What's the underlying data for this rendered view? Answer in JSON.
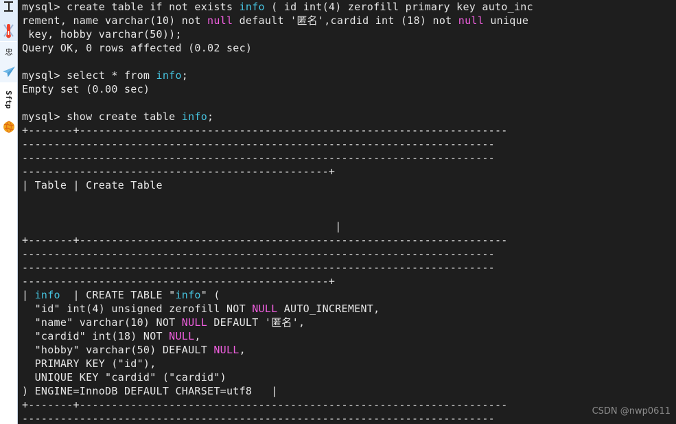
{
  "sidebar": {
    "items": [
      {
        "name": "ruler-icon",
        "label": ""
      },
      {
        "name": "thermometer-icon",
        "label": ""
      },
      {
        "name": "cjk-label-icon",
        "label": "忠"
      },
      {
        "name": "paper-plane-icon",
        "label": ""
      },
      {
        "name": "sftp-tab",
        "label": "Sftp"
      },
      {
        "name": "globe-icon",
        "label": ""
      }
    ]
  },
  "terminal": {
    "background": "#1e1e1e",
    "foreground": "#e6e6e6",
    "accent_cyan": "#46c4e0",
    "accent_magenta": "#f15fe0",
    "prompt": "mysql>",
    "lines": [
      {
        "id": "l01",
        "segments": [
          {
            "t": "mysql> create table if not exists ",
            "c": "wh"
          },
          {
            "t": "info",
            "c": "cy"
          },
          {
            "t": " ( id int(4) zerofill primary key auto_inc",
            "c": "wh"
          }
        ]
      },
      {
        "id": "l02",
        "segments": [
          {
            "t": "rement, name varchar(10) not ",
            "c": "wh"
          },
          {
            "t": "null",
            "c": "mg"
          },
          {
            "t": " default '匿名',cardid int (18) not ",
            "c": "wh"
          },
          {
            "t": "null",
            "c": "mg"
          },
          {
            "t": " unique",
            "c": "wh"
          }
        ]
      },
      {
        "id": "l03",
        "segments": [
          {
            "t": " key, hobby varchar(50));",
            "c": "wh"
          }
        ]
      },
      {
        "id": "l04",
        "segments": [
          {
            "t": "Query OK, 0 rows affected (0.02 sec)",
            "c": "wh"
          }
        ]
      },
      {
        "id": "l05",
        "segments": [
          {
            "t": "",
            "c": "wh"
          }
        ]
      },
      {
        "id": "l06",
        "segments": [
          {
            "t": "mysql> select * from ",
            "c": "wh"
          },
          {
            "t": "info",
            "c": "cy"
          },
          {
            "t": ";",
            "c": "wh"
          }
        ]
      },
      {
        "id": "l07",
        "segments": [
          {
            "t": "Empty set (0.00 sec)",
            "c": "wh"
          }
        ]
      },
      {
        "id": "l08",
        "segments": [
          {
            "t": "",
            "c": "wh"
          }
        ]
      },
      {
        "id": "l09",
        "segments": [
          {
            "t": "mysql> show create table ",
            "c": "wh"
          },
          {
            "t": "info",
            "c": "cy"
          },
          {
            "t": ";",
            "c": "wh"
          }
        ]
      },
      {
        "id": "l10",
        "segments": [
          {
            "t": "+-------+-------------------------------------------------------------------",
            "c": "wh"
          }
        ]
      },
      {
        "id": "l11",
        "segments": [
          {
            "t": "--------------------------------------------------------------------------",
            "c": "wh"
          }
        ]
      },
      {
        "id": "l12",
        "segments": [
          {
            "t": "--------------------------------------------------------------------------",
            "c": "wh"
          }
        ]
      },
      {
        "id": "l13",
        "segments": [
          {
            "t": "------------------------------------------------+",
            "c": "wh"
          }
        ]
      },
      {
        "id": "l14",
        "segments": [
          {
            "t": "| Table | Create Table",
            "c": "wh"
          }
        ]
      },
      {
        "id": "l15",
        "segments": [
          {
            "t": "",
            "c": "wh"
          }
        ]
      },
      {
        "id": "l16",
        "segments": [
          {
            "t": "",
            "c": "wh"
          }
        ]
      },
      {
        "id": "l17",
        "segments": [
          {
            "t": "                                                 |",
            "c": "wh"
          }
        ]
      },
      {
        "id": "l18",
        "segments": [
          {
            "t": "+-------+-------------------------------------------------------------------",
            "c": "wh"
          }
        ]
      },
      {
        "id": "l19",
        "segments": [
          {
            "t": "--------------------------------------------------------------------------",
            "c": "wh"
          }
        ]
      },
      {
        "id": "l20",
        "segments": [
          {
            "t": "--------------------------------------------------------------------------",
            "c": "wh"
          }
        ]
      },
      {
        "id": "l21",
        "segments": [
          {
            "t": "------------------------------------------------+",
            "c": "wh"
          }
        ]
      },
      {
        "id": "l22",
        "segments": [
          {
            "t": "| ",
            "c": "wh"
          },
          {
            "t": "info",
            "c": "cy"
          },
          {
            "t": "  | CREATE TABLE \"",
            "c": "wh"
          },
          {
            "t": "info",
            "c": "cy"
          },
          {
            "t": "\" (",
            "c": "wh"
          }
        ]
      },
      {
        "id": "l23",
        "segments": [
          {
            "t": "  \"id\" int(4) unsigned zerofill NOT ",
            "c": "wh"
          },
          {
            "t": "NULL",
            "c": "mg"
          },
          {
            "t": " AUTO_INCREMENT,",
            "c": "wh"
          }
        ]
      },
      {
        "id": "l24",
        "segments": [
          {
            "t": "  \"name\" varchar(10) NOT ",
            "c": "wh"
          },
          {
            "t": "NULL",
            "c": "mg"
          },
          {
            "t": " DEFAULT '匿名',",
            "c": "wh"
          }
        ]
      },
      {
        "id": "l25",
        "segments": [
          {
            "t": "  \"cardid\" int(18) NOT ",
            "c": "wh"
          },
          {
            "t": "NULL",
            "c": "mg"
          },
          {
            "t": ",",
            "c": "wh"
          }
        ]
      },
      {
        "id": "l26",
        "segments": [
          {
            "t": "  \"hobby\" varchar(50) DEFAULT ",
            "c": "wh"
          },
          {
            "t": "NULL",
            "c": "mg"
          },
          {
            "t": ",",
            "c": "wh"
          }
        ]
      },
      {
        "id": "l27",
        "segments": [
          {
            "t": "  PRIMARY KEY (\"id\"),",
            "c": "wh"
          }
        ]
      },
      {
        "id": "l28",
        "segments": [
          {
            "t": "  UNIQUE KEY \"cardid\" (\"cardid\")",
            "c": "wh"
          }
        ]
      },
      {
        "id": "l29",
        "segments": [
          {
            "t": ") ENGINE=InnoDB DEFAULT CHARSET=utf8   |",
            "c": "wh"
          }
        ]
      },
      {
        "id": "l30",
        "segments": [
          {
            "t": "+-------+-------------------------------------------------------------------",
            "c": "wh"
          }
        ]
      },
      {
        "id": "l31",
        "segments": [
          {
            "t": "--------------------------------------------------------------------------",
            "c": "wh"
          }
        ]
      }
    ]
  },
  "watermark": {
    "text": "CSDN @nwp0611"
  }
}
